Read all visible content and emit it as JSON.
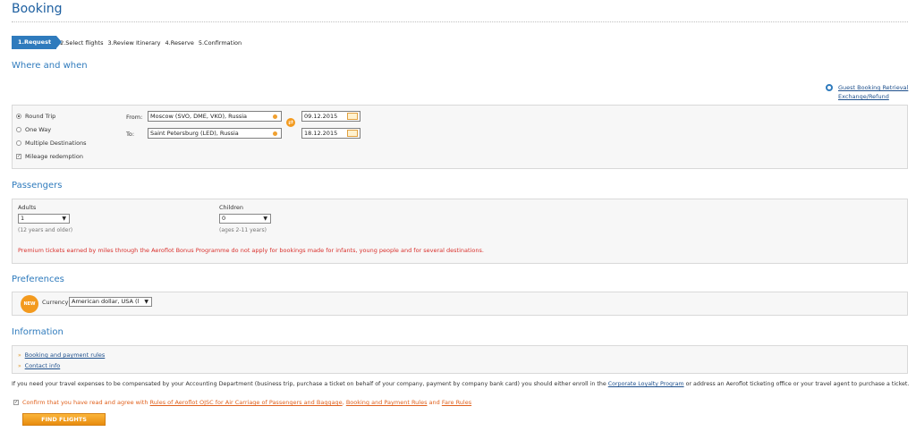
{
  "page": {
    "title": "Booking"
  },
  "steps": [
    "1.Request",
    "2.Select flights",
    "3.Review Itinerary",
    "4.Reserve",
    "5.Confirmation"
  ],
  "where": {
    "heading": "Where and when",
    "guest_link": "Guest Booking Retrieval",
    "exchange_link": "Exchange/Refund",
    "trip_options": [
      "Round Trip",
      "One Way",
      "Multiple Destinations"
    ],
    "mileage": "Mileage redemption",
    "from_label": "From:",
    "to_label": "To:",
    "from_value": "Moscow (SVO, DME, VKO), Russia",
    "to_value": "Saint Petersburg (LED), Russia",
    "depart_date": "09.12.2015",
    "return_date": "18.12.2015"
  },
  "passengers": {
    "heading": "Passengers",
    "adults_label": "Adults",
    "adults_value": "1",
    "adults_note": "(12 years and older)",
    "children_label": "Children",
    "children_value": "0",
    "children_note": "(ages 2-11 years)",
    "warning": "Premium tickets earned by miles through the Aeroflot Bonus Programme do not apply for bookings made for infants, young people and for several destinations."
  },
  "preferences": {
    "heading": "Preferences",
    "new_badge": "NEW",
    "currency_label": "Currency",
    "currency_value": "American dollar, USA (l"
  },
  "information": {
    "heading": "Information",
    "links": [
      "Booking and payment rules",
      "Contact info"
    ]
  },
  "notice": {
    "before": "If you need your travel expenses to be compensated by your Accounting Department (business trip, purchase a ticket on behalf of your company, payment by company bank card) you should either enroll in the ",
    "link": "Corporate Loyalty Program",
    "after": " or address an Aeroflot ticketing office or your travel agent to purchase a ticket."
  },
  "confirm": {
    "pre": "Confirm that you have read and agree with ",
    "link1": "Rules of Aeroflot OJSC for Air Carriage of Passengers and Baggage",
    "sep1": ", ",
    "link2": "Booking and Payment Rules",
    "sep2": " and ",
    "link3": "Fare Rules"
  },
  "find_button": "FIND FLIGHTS"
}
